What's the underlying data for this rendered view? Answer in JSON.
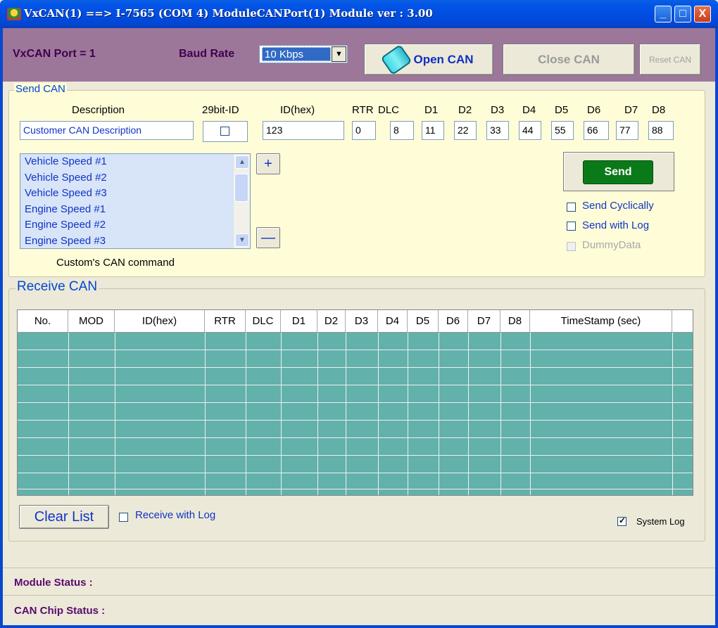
{
  "window": {
    "title": "VxCAN(1) ==> I-7565 (COM 4) ModuleCANPort(1) Module ver : 3.00",
    "minimize": "_",
    "maximize": "□",
    "close": "X"
  },
  "toolbar": {
    "port_label": "VxCAN Port = 1",
    "baud_label": "Baud Rate",
    "baud_value": "10 Kbps",
    "open_label": "Open CAN",
    "close_label": "Close CAN",
    "reset_label": "Reset CAN"
  },
  "send": {
    "group_title": "Send CAN",
    "headers": {
      "description": "Description",
      "ext_id": "29bit-ID",
      "id": "ID(hex)",
      "rtr": "RTR",
      "dlc": "DLC",
      "d": [
        "D1",
        "D2",
        "D3",
        "D4",
        "D5",
        "D6",
        "D7",
        "D8"
      ]
    },
    "description_value": "Customer CAN Description",
    "ext_id_checked": false,
    "id_value": "123",
    "rtr_value": "0",
    "dlc_value": "8",
    "data_values": [
      "11",
      "22",
      "33",
      "44",
      "55",
      "66",
      "77",
      "88"
    ],
    "commands": [
      "Vehicle Speed #1",
      "Vehicle Speed #2",
      "Vehicle Speed #3",
      "Engine Speed #1",
      "Engine Speed #2",
      "Engine Speed #3"
    ],
    "add_label": "+",
    "remove_label": "—",
    "list_caption": "Custom's CAN command",
    "send_label": "Send",
    "cyclic_label": "Send Cyclically",
    "log_label": "Send with Log",
    "dummy_label": "DummyData"
  },
  "receive": {
    "group_title": "Receive CAN",
    "columns": [
      "No.",
      "MOD",
      "ID(hex)",
      "RTR",
      "DLC",
      "D1",
      "D2",
      "D3",
      "D4",
      "D5",
      "D6",
      "D7",
      "D8",
      "TimeStamp (sec)",
      ""
    ],
    "clear_label": "Clear List",
    "log_label": "Receive with Log",
    "system_log_label": "System Log",
    "system_log_checked": true,
    "grid_color": "#62b1ab"
  },
  "status": {
    "module_label": "Module Status :",
    "chip_label": "CAN Chip Status :"
  },
  "colors": {
    "toolbar": "#9d779a",
    "send_panel": "#fffdd8",
    "send_button": "#0a7a18",
    "label_blue": "#1034c8",
    "status_purple": "#5a0a6e"
  }
}
